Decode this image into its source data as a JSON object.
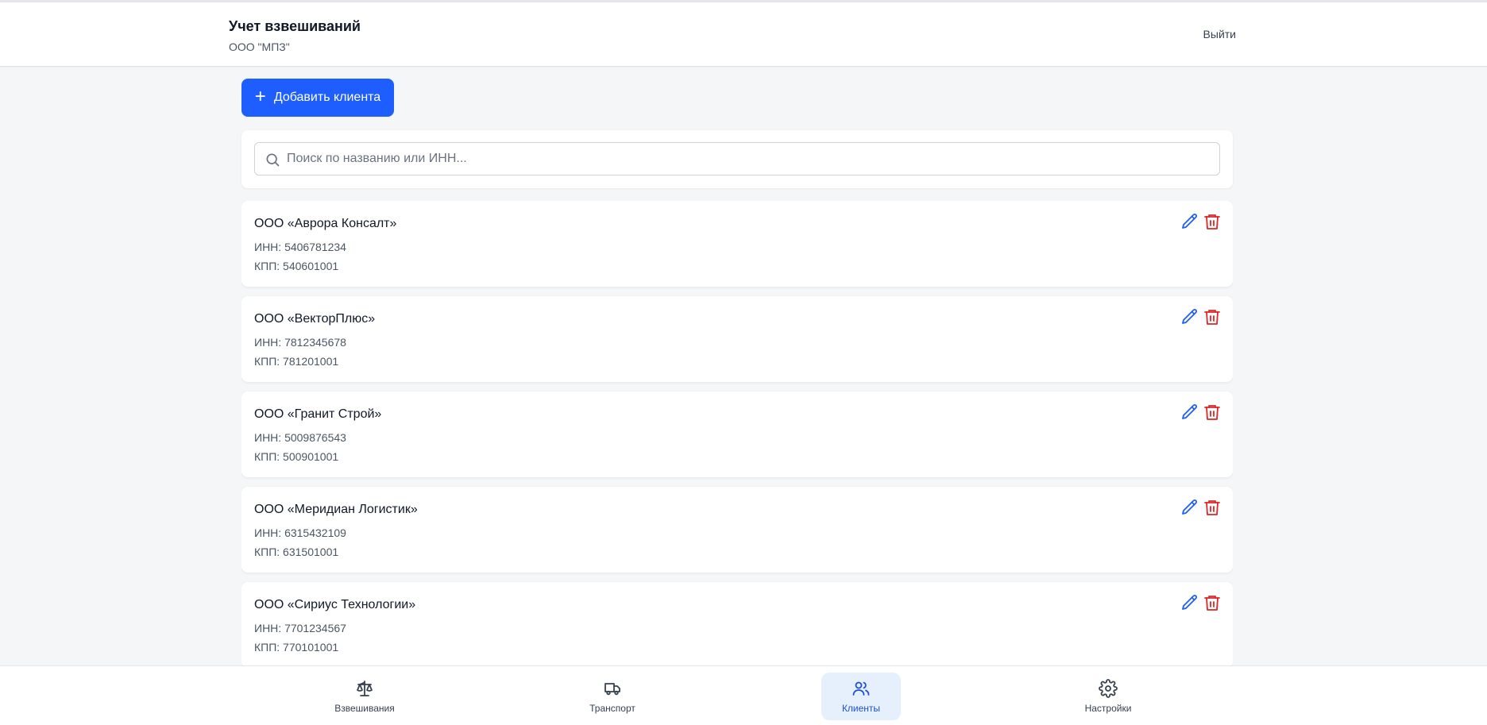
{
  "header": {
    "title": "Учет взвешиваний",
    "org": "ООО \"МПЗ\"",
    "logout": "Выйти"
  },
  "actions": {
    "add_client": "Добавить клиента"
  },
  "search": {
    "placeholder": "Поиск по названию или ИНН...",
    "value": ""
  },
  "clients": [
    {
      "name": "ООО «Аврора Консалт»",
      "inn": "ИНН: 5406781234",
      "kpp": "КПП: 540601001"
    },
    {
      "name": "ООО «ВекторПлюс»",
      "inn": "ИНН: 7812345678",
      "kpp": "КПП: 781201001"
    },
    {
      "name": "ООО «Гранит Строй»",
      "inn": "ИНН: 5009876543",
      "kpp": "КПП: 500901001"
    },
    {
      "name": "ООО «Меридиан Логистик»",
      "inn": "ИНН: 6315432109",
      "kpp": "КПП: 631501001"
    },
    {
      "name": "ООО «Сириус Технологии»",
      "inn": "ИНН: 7701234567",
      "kpp": "КПП: 770101001"
    }
  ],
  "nav": {
    "weighings": {
      "label": "Взвешивания",
      "icon": "scale-icon"
    },
    "transport": {
      "label": "Транспорт",
      "icon": "truck-icon"
    },
    "clients": {
      "label": "Клиенты",
      "icon": "users-icon",
      "active": true
    },
    "settings": {
      "label": "Настройки",
      "icon": "gear-icon"
    }
  },
  "colors": {
    "accent": "#1e5eff",
    "edit": "#1e5eff",
    "delete": "#dc2626",
    "nav_active_bg": "#e6f0fd"
  }
}
